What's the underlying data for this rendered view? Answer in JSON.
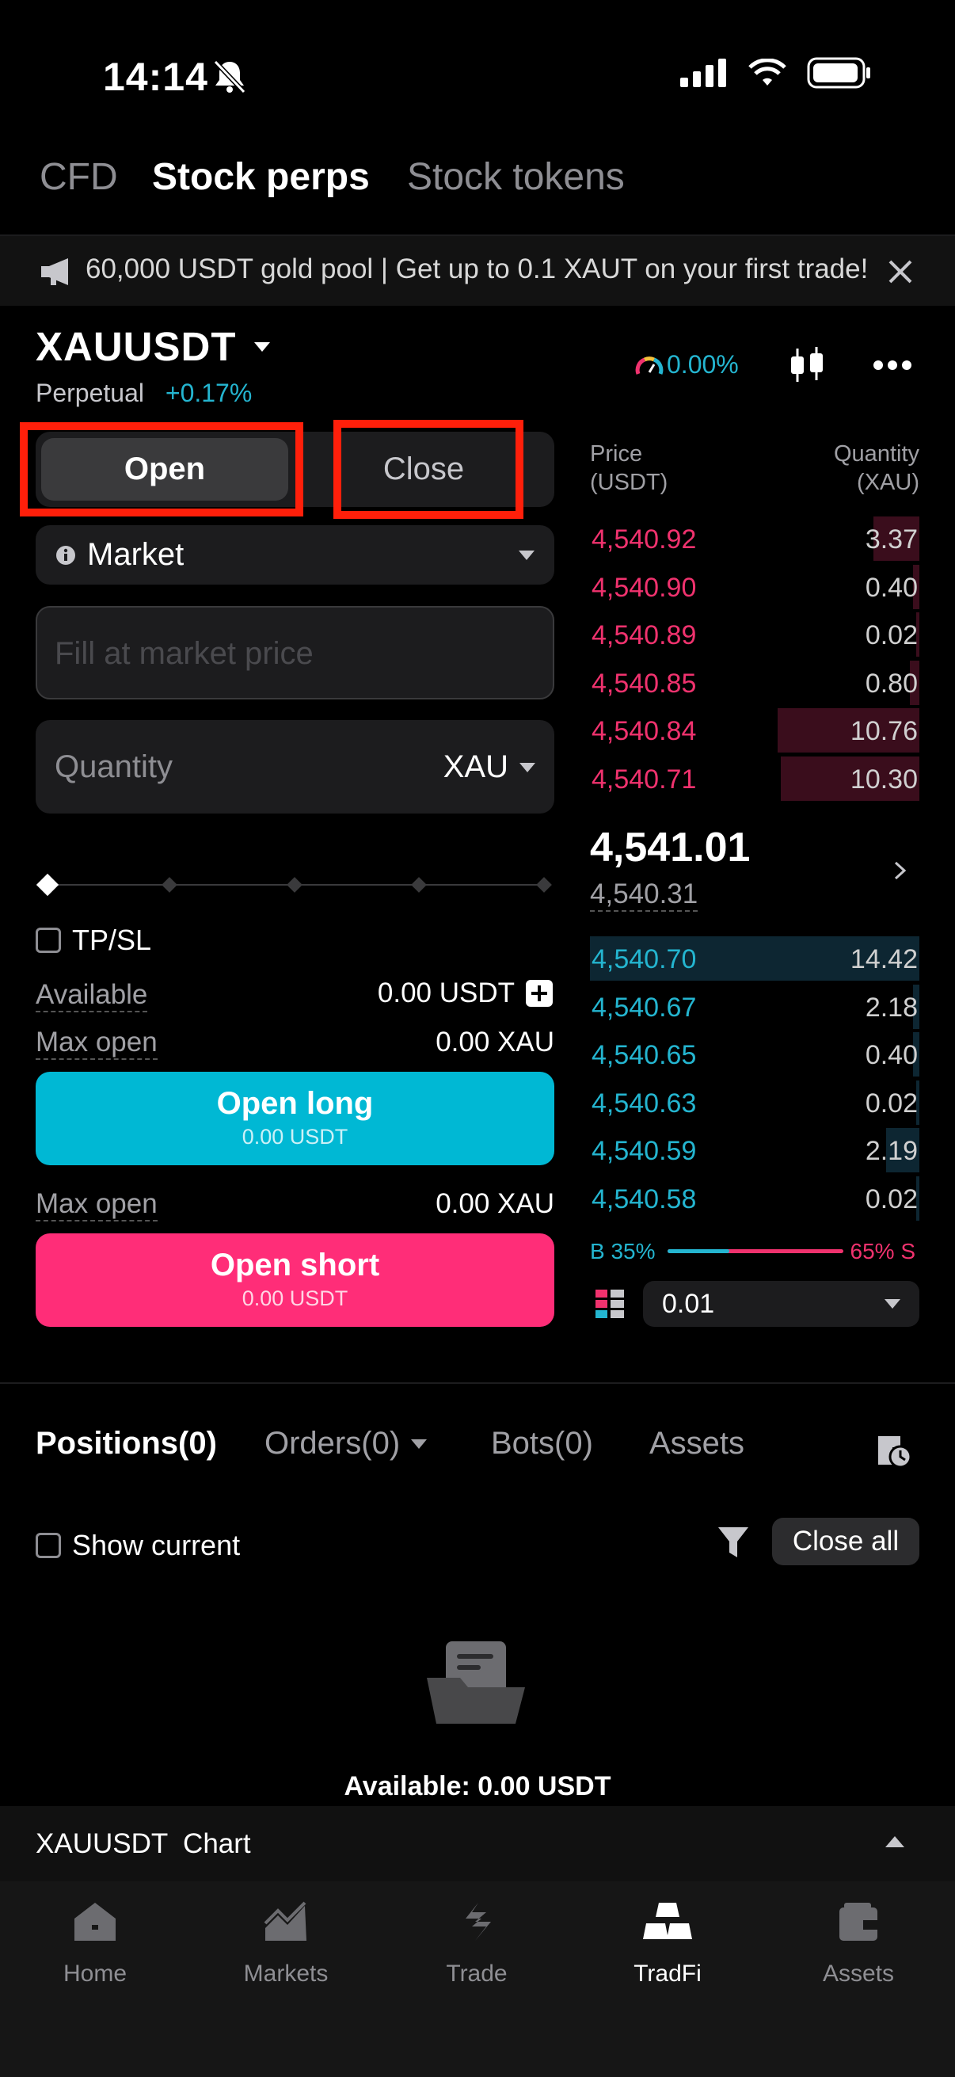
{
  "status": {
    "time": "14:14"
  },
  "top_tabs": [
    "CFD",
    "Stock perps",
    "Stock tokens"
  ],
  "announcement": "60,000 USDT gold pool | Get up to 0.1 XAUT on your first trade!",
  "instrument": {
    "symbol": "XAUUSDT",
    "type": "Perpetual",
    "change": "+0.17%",
    "funding": "0.00%"
  },
  "order_form": {
    "open_label": "Open",
    "close_label": "Close",
    "order_type": "Market",
    "price_placeholder": "Fill at market price",
    "quantity_label": "Quantity",
    "quantity_unit": "XAU",
    "tpsl_label": "TP/SL",
    "available_label": "Available",
    "available_value": "0.00 USDT",
    "max_open_label": "Max open",
    "max_open_value": "0.00 XAU",
    "long_label": "Open long",
    "long_sub": "0.00 USDT",
    "short_label": "Open short",
    "short_sub": "0.00 USDT"
  },
  "order_book": {
    "price_header": "Price\n(USDT)",
    "qty_header": "Quantity\n(XAU)",
    "asks": [
      {
        "price": "4,540.92",
        "qty": "3.37",
        "depth": 0.14
      },
      {
        "price": "4,540.90",
        "qty": "0.40",
        "depth": 0.02
      },
      {
        "price": "4,540.89",
        "qty": "0.02",
        "depth": 0.01
      },
      {
        "price": "4,540.85",
        "qty": "0.80",
        "depth": 0.03
      },
      {
        "price": "4,540.84",
        "qty": "10.76",
        "depth": 0.43
      },
      {
        "price": "4,540.71",
        "qty": "10.30",
        "depth": 0.42
      }
    ],
    "last_price": "4,541.01",
    "mark_price": "4,540.31",
    "bids": [
      {
        "price": "4,540.70",
        "qty": "14.42",
        "depth": 1.0
      },
      {
        "price": "4,540.67",
        "qty": "2.18",
        "depth": 0.02
      },
      {
        "price": "4,540.65",
        "qty": "0.40",
        "depth": 0.02
      },
      {
        "price": "4,540.63",
        "qty": "0.02",
        "depth": 0.01
      },
      {
        "price": "4,540.59",
        "qty": "2.19",
        "depth": 0.1
      },
      {
        "price": "4,540.58",
        "qty": "0.02",
        "depth": 0.01
      }
    ],
    "buy_ratio": "B 35%",
    "sell_ratio": "65% S",
    "buy_fraction": 0.35,
    "precision": "0.01"
  },
  "positions_tabs": {
    "positions": "Positions(0)",
    "orders": "Orders(0)",
    "bots": "Bots(0)",
    "assets": "Assets"
  },
  "show_current": "Show current",
  "close_all": "Close all",
  "empty_available": "Available: 0.00 USDT",
  "chart_bar": "XAUUSDT  Chart",
  "nav": [
    "Home",
    "Markets",
    "Trade",
    "TradFi",
    "Assets"
  ],
  "colors": {
    "buy": "#24b5d0",
    "sell": "#f0326e",
    "brand_short": "#ff2d78"
  }
}
